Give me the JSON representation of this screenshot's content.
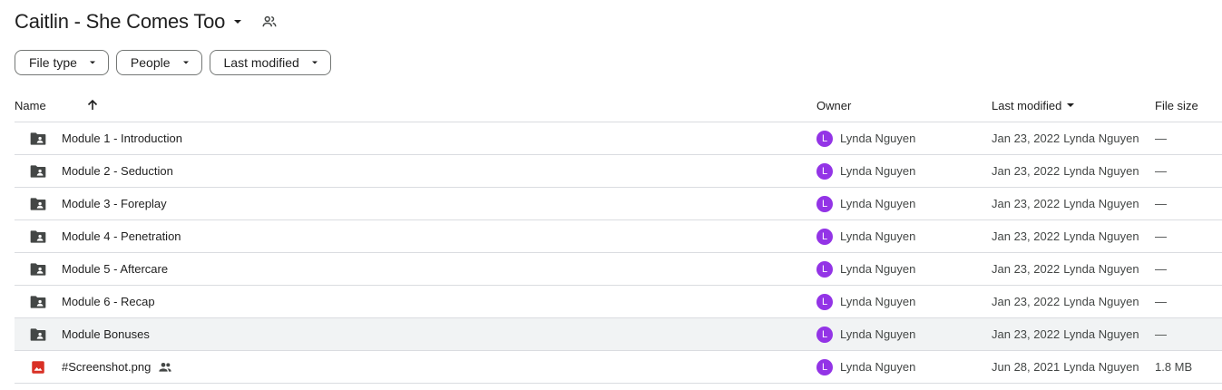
{
  "title": "Caitlin - She Comes Too",
  "filters": [
    "File type",
    "People",
    "Last modified"
  ],
  "columns": {
    "name": "Name",
    "owner": "Owner",
    "last_modified": "Last modified",
    "file_size": "File size"
  },
  "rows": [
    {
      "name": "Module 1 - Introduction",
      "owner_initial": "L",
      "owner": "Lynda Nguyen",
      "date": "Jan 23, 2022",
      "modified_by": "Lynda Nguyen",
      "size": "—",
      "icon": "shared-folder-icon"
    },
    {
      "name": "Module 2 - Seduction",
      "owner_initial": "L",
      "owner": "Lynda Nguyen",
      "date": "Jan 23, 2022",
      "modified_by": "Lynda Nguyen",
      "size": "—",
      "icon": "shared-folder-icon"
    },
    {
      "name": "Module 3 - Foreplay",
      "owner_initial": "L",
      "owner": "Lynda Nguyen",
      "date": "Jan 23, 2022",
      "modified_by": "Lynda Nguyen",
      "size": "—",
      "icon": "shared-folder-icon"
    },
    {
      "name": "Module 4 - Penetration",
      "owner_initial": "L",
      "owner": "Lynda Nguyen",
      "date": "Jan 23, 2022",
      "modified_by": "Lynda Nguyen",
      "size": "—",
      "icon": "shared-folder-icon"
    },
    {
      "name": "Module 5 - Aftercare",
      "owner_initial": "L",
      "owner": "Lynda Nguyen",
      "date": "Jan 23, 2022",
      "modified_by": "Lynda Nguyen",
      "size": "—",
      "icon": "shared-folder-icon"
    },
    {
      "name": "Module 6 - Recap",
      "owner_initial": "L",
      "owner": "Lynda Nguyen",
      "date": "Jan 23, 2022",
      "modified_by": "Lynda Nguyen",
      "size": "—",
      "icon": "shared-folder-icon"
    },
    {
      "name": "Module Bonuses",
      "owner_initial": "L",
      "owner": "Lynda Nguyen",
      "date": "Jan 23, 2022",
      "modified_by": "Lynda Nguyen",
      "size": "—",
      "icon": "shared-folder-icon"
    },
    {
      "name": "#Screenshot.png",
      "owner_initial": "L",
      "owner": "Lynda Nguyen",
      "date": "Jun 28, 2021",
      "modified_by": "Lynda Nguyen",
      "size": "1.8 MB",
      "icon": "image-file-icon"
    }
  ],
  "colors": {
    "avatar": "#9334e6",
    "folder_icon": "#444746",
    "image_icon": "#d93025",
    "selected_row": "#f1f3f4"
  }
}
